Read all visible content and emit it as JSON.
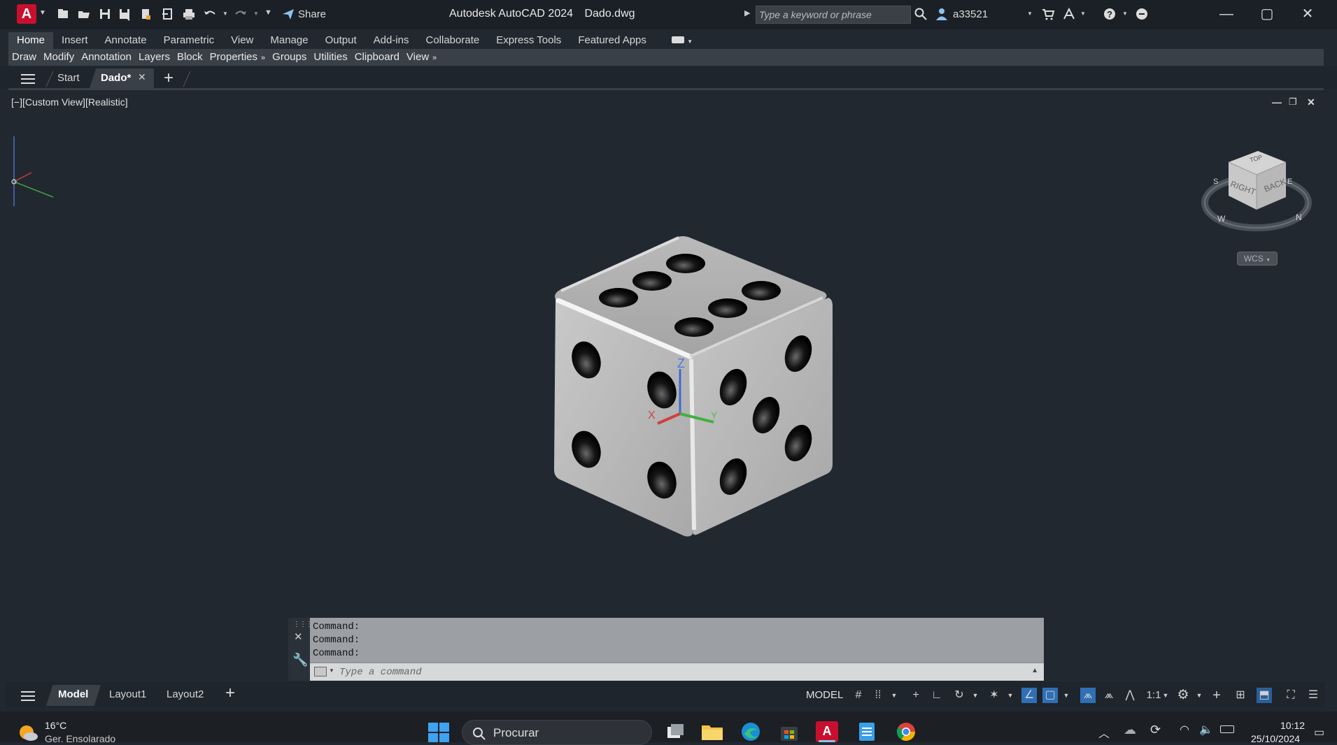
{
  "titlebar": {
    "app_logo": "A",
    "share_label": "Share",
    "app_title": "Autodesk AutoCAD 2024",
    "file_title": "Dado.dwg",
    "search_placeholder": "Type a keyword or phrase",
    "username": "a33521"
  },
  "ribbon": {
    "tabs": [
      "Home",
      "Insert",
      "Annotate",
      "Parametric",
      "View",
      "Manage",
      "Output",
      "Add-ins",
      "Collaborate",
      "Express Tools",
      "Featured Apps"
    ],
    "active_tab": "Home",
    "panels": [
      "Draw",
      "Modify",
      "Annotation",
      "Layers",
      "Block",
      "Properties",
      "Groups",
      "Utilities",
      "Clipboard",
      "View"
    ]
  },
  "filetabs": {
    "start": "Start",
    "current": "Dado*"
  },
  "viewport": {
    "label": "[−][Custom View][Realistic]",
    "viewcube": {
      "right": "RIGHT",
      "back": "BACK",
      "top": "TOP",
      "wcs": "WCS"
    },
    "compass": {
      "s": "S",
      "w": "W",
      "n": "N",
      "e": "E"
    },
    "ucs": {
      "z": "Z",
      "y": "Y",
      "x": "X"
    }
  },
  "command": {
    "history": [
      "Command:",
      "Command:",
      "Command:"
    ],
    "placeholder": "Type a command"
  },
  "layout_tabs": [
    "Model",
    "Layout1",
    "Layout2"
  ],
  "status": {
    "model_label": "MODEL",
    "scale_label": "1:1"
  },
  "taskbar": {
    "temperature": "16°C",
    "weather": "Ger. Ensolarado",
    "search_label": "Procurar",
    "time": "10:12",
    "date": "25/10/2024"
  },
  "colors": {
    "accent": "#2f6fb5",
    "background": "#212830",
    "autocad_red": "#c8102e"
  }
}
